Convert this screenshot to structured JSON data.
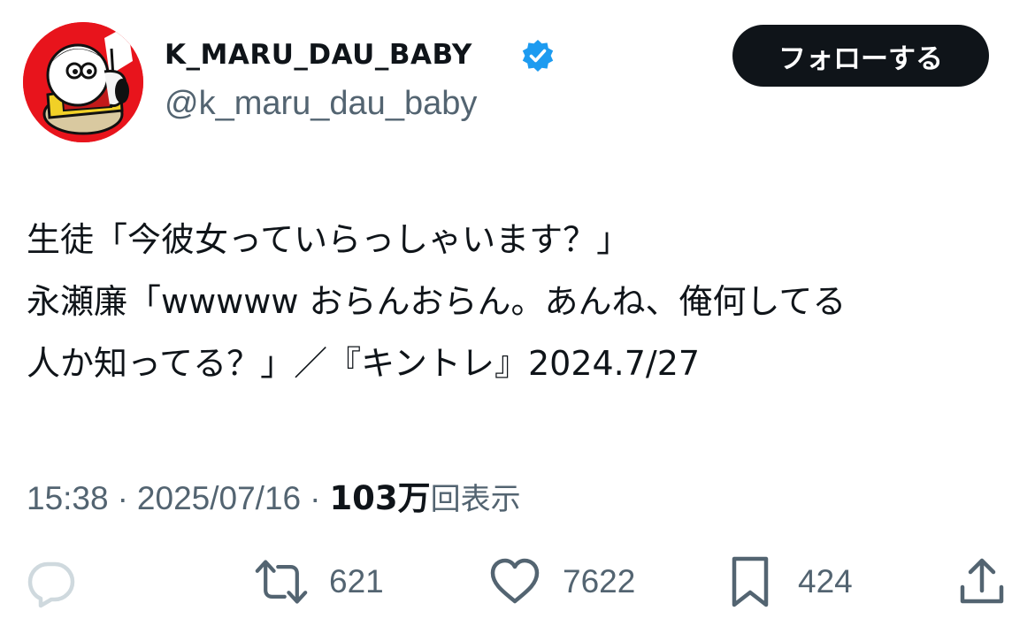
{
  "author": {
    "display_name": "K_MARU_DAU_BABY",
    "handle": "@k_maru_dau_baby",
    "verified_icon": "verified-badge-icon"
  },
  "follow_button": {
    "label": "フォローする"
  },
  "tweet": {
    "lines": [
      "生徒「今彼女っていらっしゃいます？」",
      "永瀬廉「wwwww おらんおらん。あんね、俺何してる",
      "人か知ってる？」／『キントレ』2024.7/27"
    ]
  },
  "meta": {
    "time": "15:38",
    "separator": "·",
    "date": "2025/07/16",
    "views_count": "103万",
    "views_label": "回表示"
  },
  "actions": {
    "reply": {
      "icon": "reply-icon"
    },
    "retweet": {
      "icon": "retweet-icon",
      "count": "621"
    },
    "like": {
      "icon": "heart-icon",
      "count": "7622"
    },
    "bookmark": {
      "icon": "bookmark-icon",
      "count": "424"
    },
    "share": {
      "icon": "share-icon"
    }
  },
  "colors": {
    "text": "#0f1419",
    "secondary": "#536471",
    "verified": "#1d9bf0",
    "avatar_bg": "#e8141c",
    "follow_bg": "#0f1419"
  }
}
